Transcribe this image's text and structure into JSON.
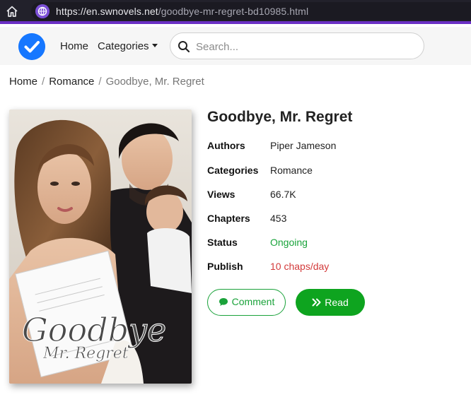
{
  "browser": {
    "url_host": "https://en.swnovels.net",
    "url_path": "/goodbye-mr-regret-bd10985.html"
  },
  "nav": {
    "home": "Home",
    "categories": "Categories",
    "search_placeholder": "Search..."
  },
  "breadcrumb": {
    "home": "Home",
    "category": "Romance",
    "current": "Goodbye, Mr. Regret"
  },
  "cover": {
    "title_line1": "Goodbye",
    "title_line2": "Mr. Regret"
  },
  "book": {
    "title": "Goodbye, Mr. Regret",
    "details": [
      {
        "label": "Authors",
        "value": "Piper Jameson"
      },
      {
        "label": "Categories",
        "value": "Romance"
      },
      {
        "label": "Views",
        "value": "66.7K"
      },
      {
        "label": "Chapters",
        "value": "453"
      },
      {
        "label": "Status",
        "value": "Ongoing"
      },
      {
        "label": "Publish",
        "value": "10 chaps/day"
      }
    ]
  },
  "actions": {
    "comment": "Comment",
    "read": "Read"
  },
  "colors": {
    "accent_green": "#0ea41f",
    "status_red": "#d33a3a",
    "brand_blue": "#1677ff",
    "browser_purple": "#6a2fc4"
  }
}
